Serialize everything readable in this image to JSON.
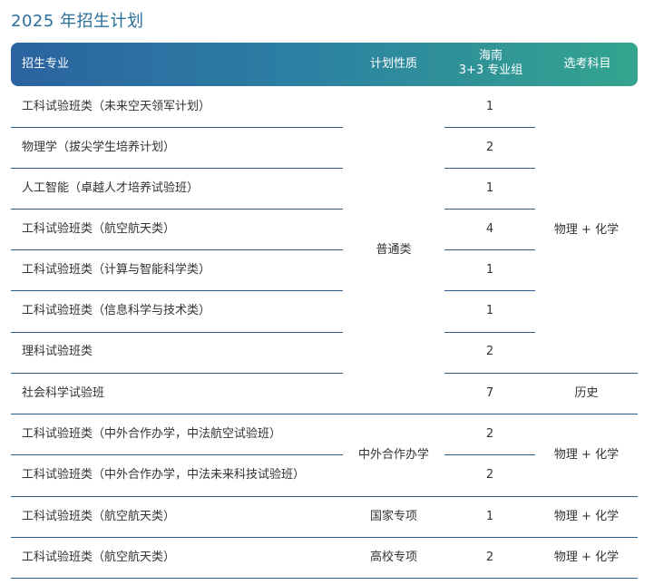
{
  "page_title": "2025 年招生计划",
  "table": {
    "headers": {
      "major": "招生专业",
      "nature": "计划性质",
      "group_line1": "海南",
      "group_line2": "3+3 专业组",
      "subjects": "选考科目"
    },
    "rows": [
      {
        "major": "工科试验班类（未来空天领军计划）",
        "count": "1"
      },
      {
        "major": "物理学（拔尖学生培养计划）",
        "count": "2"
      },
      {
        "major": "人工智能（卓越人才培养试验班）",
        "count": "1"
      },
      {
        "major": "工科试验班类（航空航天类）",
        "count": "4"
      },
      {
        "major": "工科试验班类（计算与智能科学类）",
        "count": "1"
      },
      {
        "major": "工科试验班类（信息科学与技术类）",
        "count": "1"
      },
      {
        "major": "理科试验班类",
        "count": "2"
      },
      {
        "major": "社会科学试验班",
        "count": "7"
      },
      {
        "major": "工科试验班类（中外合作办学，中法航空试验班）",
        "count": "2"
      },
      {
        "major": "工科试验班类（中外合作办学，中法未来科技试验班）",
        "count": "2"
      },
      {
        "major": "工科试验班类（航空航天类）",
        "count": "1"
      },
      {
        "major": "工科试验班类（航空航天类）",
        "count": "2"
      }
    ],
    "nature_groups": [
      "普通类",
      "中外合作办学",
      "国家专项",
      "高校专项"
    ],
    "subject_groups": [
      "物理 + 化学",
      "历史",
      "物理 + 化学",
      "物理 + 化学",
      "物理 + 化学"
    ]
  }
}
